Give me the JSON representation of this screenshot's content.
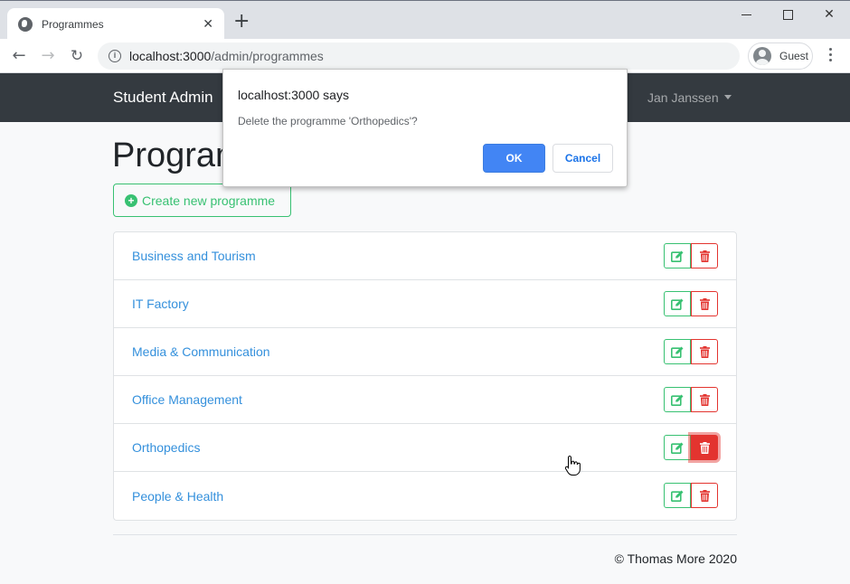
{
  "browser": {
    "tab_title": "Programmes",
    "tab_icon": "globe-icon",
    "url_host": "localhost:3000",
    "url_path": "/admin/programmes",
    "profile_label": "Guest"
  },
  "app": {
    "brand": "Student Admin",
    "user_name": "Jan Janssen",
    "page_title": "Programmes",
    "create_button_label": "Create new programme",
    "colors": {
      "success": "#38c172",
      "danger": "#e3342f",
      "link": "#3490dc",
      "navbar": "#343a40"
    }
  },
  "programmes": [
    {
      "name": "Business and Tourism"
    },
    {
      "name": "IT Factory"
    },
    {
      "name": "Media & Communication"
    },
    {
      "name": "Office Management"
    },
    {
      "name": "Orthopedics"
    },
    {
      "name": "People & Health"
    }
  ],
  "footer": {
    "text": "© Thomas More 2020"
  },
  "dialog": {
    "title": "localhost:3000 says",
    "message": "Delete the programme 'Orthopedics'?",
    "ok_label": "OK",
    "cancel_label": "Cancel"
  }
}
